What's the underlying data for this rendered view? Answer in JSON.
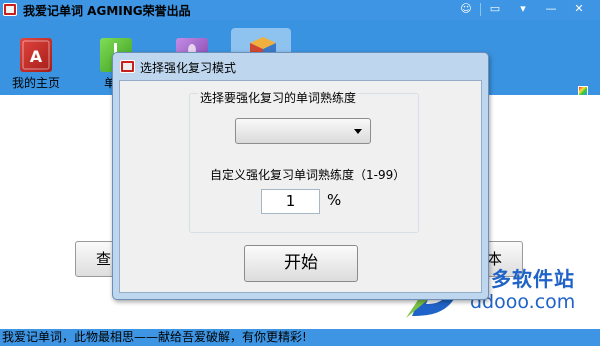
{
  "app": {
    "title": "我爱记单词 AGMING荣誉出品",
    "window_controls": [
      "☺",
      "▭",
      "▾",
      "—",
      "✕"
    ]
  },
  "toolbar": {
    "items": [
      {
        "label": "我的主页",
        "icon": "home-book-icon",
        "color": "#c9302c"
      },
      {
        "label": "单词",
        "icon": "word-book-icon",
        "color": "#5cbf3a"
      },
      {
        "label": "",
        "icon": "purple-book-icon",
        "color": "#9b59c6"
      },
      {
        "label": "",
        "icon": "review-cube-icon",
        "color": "#e8a03a"
      }
    ]
  },
  "background_buttons": {
    "left_label": "查",
    "right_label": "本"
  },
  "dialog": {
    "title": "选择强化复习模式",
    "group_label": "选择要强化复习的单词熟练度",
    "combo_value": "",
    "custom_label": "自定义强化复习单词熟练度（1-99）",
    "percent_value": "1",
    "percent_sign": "%",
    "start_button": "开始"
  },
  "statusbar": {
    "text": "我爱记单词，此物最相思——献给吾爱破解，有你更精彩!"
  },
  "watermark": {
    "name": "多多软件站",
    "url": "ddooo.com"
  },
  "colors": {
    "titlebar": "#3d95e3",
    "toolbar": "#3a93e1",
    "dialog_frame": "#bed7ee",
    "watermark": "#1f63c8"
  }
}
